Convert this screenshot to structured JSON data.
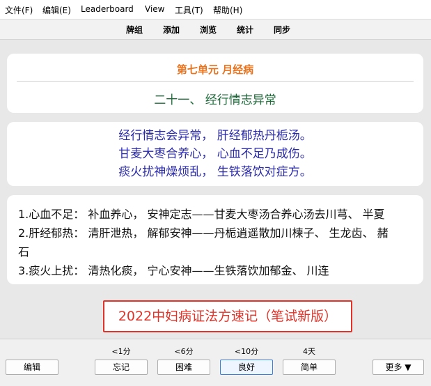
{
  "menubar": {
    "file": "文件(F)",
    "edit": "编辑(E)",
    "leaderboard": "Leaderboard",
    "view": "View",
    "tools": "工具(T)",
    "help": "帮助(H)"
  },
  "toolbar": {
    "decks": "牌组",
    "add": "添加",
    "browse": "浏览",
    "stats": "统计",
    "sync": "同步"
  },
  "card": {
    "unit_title": "第七单元 月经病",
    "section_title": "二十一、 经行情志异常",
    "poem": [
      "经行情志会异常， 肝经郁热丹栀汤。",
      "甘麦大枣合养心， 心血不足乃成伤。",
      "痰火扰神燥烦乱， 生铁落饮对症方。"
    ],
    "notes": [
      "1.心血不足： 补血养心， 安神定志——甘麦大枣汤合养心汤去川芎、 半夏",
      "2.肝经郁热： 清肝泄热， 解郁安神——丹栀逍遥散加川楝子、 生龙齿、 赭",
      "石",
      "3.痰火上扰： 清热化痰， 宁心安神——生铁落饮加郁金、 川连"
    ],
    "book_label": "2022中妇病证法方速记（笔试新版）"
  },
  "review": {
    "edit_label": "编辑",
    "more_label": "更多 ▼",
    "answers": [
      {
        "interval": "<1分",
        "label": "忘记"
      },
      {
        "interval": "<6分",
        "label": "困难"
      },
      {
        "interval": "<10分",
        "label": "良好"
      },
      {
        "interval": "4天",
        "label": "简单"
      }
    ]
  },
  "colors": {
    "unit_title": "#e8731f",
    "section_title": "#1e6b3a",
    "poem": "#2a2aaa",
    "book_label": "#e0342a"
  }
}
